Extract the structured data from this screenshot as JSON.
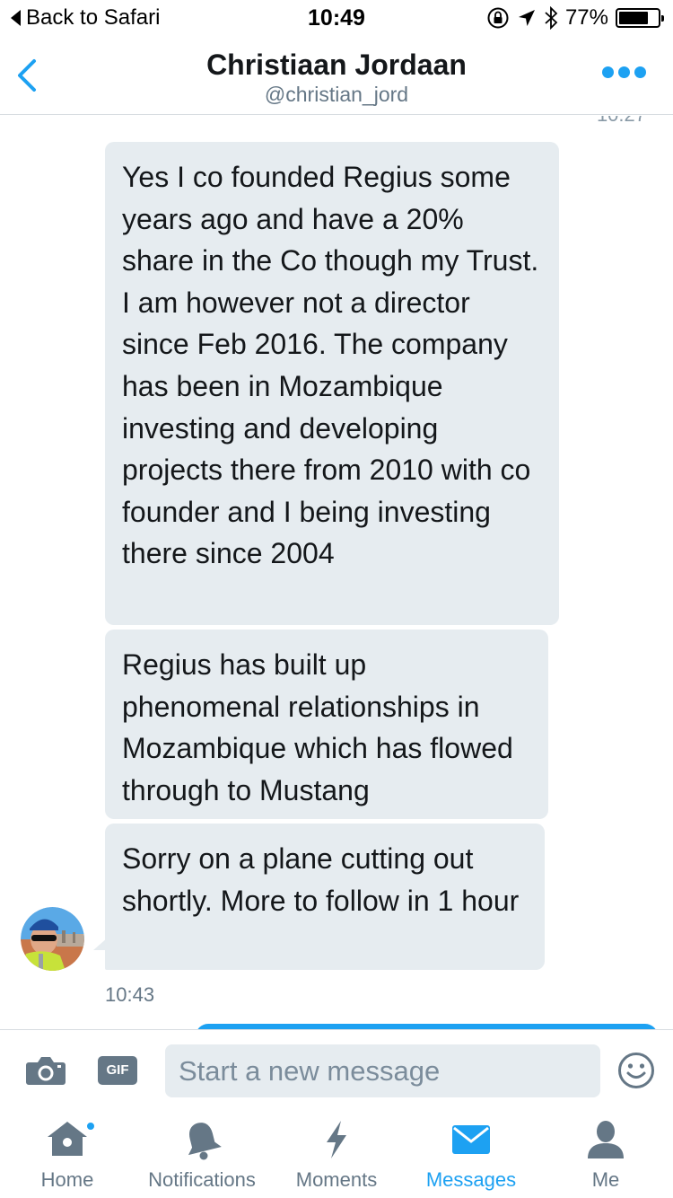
{
  "status_bar": {
    "back_label": "Back to Safari",
    "time": "10:49",
    "battery": "77%",
    "battery_level": 0.77
  },
  "header": {
    "name": "Christiaan Jordaan",
    "handle": "@christian_jord"
  },
  "conversation": {
    "clipped_timestamp": "10:27",
    "messages": [
      "Yes I co founded Regius some years ago and have a 20% share in the Co though my Trust. I am however not a director since Feb 2016. The company has been in Mozambique investing and developing projects there from 2010 with co founder and I being investing there since 2004",
      "Regius has built up phenomenal relationships in Mozambique which has flowed through to Mustang",
      "Sorry on a plane cutting out shortly. More to follow in 1 hour"
    ],
    "time": "10:43"
  },
  "composer": {
    "gif_label": "GIF",
    "placeholder": "Start a new message"
  },
  "tabs": [
    {
      "label": "Home",
      "icon": "home-icon"
    },
    {
      "label": "Notifications",
      "icon": "bell-icon"
    },
    {
      "label": "Moments",
      "icon": "lightning-icon"
    },
    {
      "label": "Messages",
      "icon": "envelope-icon"
    },
    {
      "label": "Me",
      "icon": "person-icon"
    }
  ],
  "active_tab": "Messages",
  "colors": {
    "accent": "#1da1f2",
    "bubble": "#e6ecf0",
    "muted": "#657786"
  }
}
